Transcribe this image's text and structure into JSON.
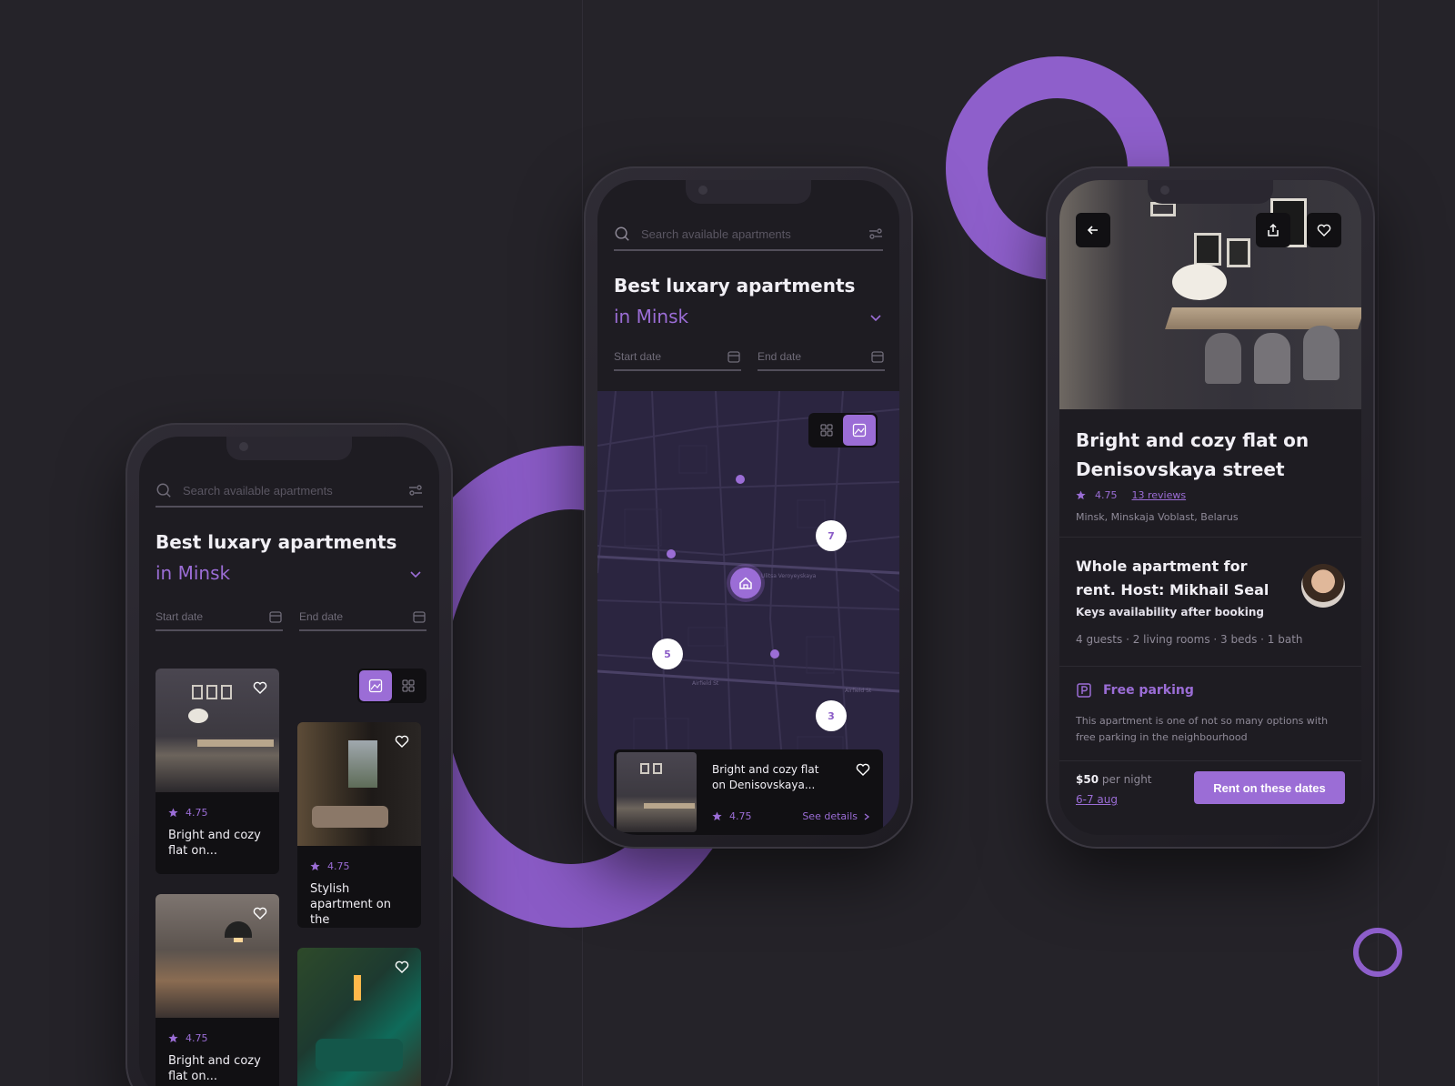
{
  "search": {
    "placeholder": "Search available apartments"
  },
  "heading": {
    "line1": "Best luxary apartments",
    "line2": "in Minsk"
  },
  "dates": {
    "start": "Start date",
    "end": "End date"
  },
  "list_cards": [
    {
      "rating": "4.75",
      "title": "Bright and cozy flat on..."
    },
    {
      "rating": "4.75",
      "title": "Stylish apartment on the"
    },
    {
      "rating": "4.75",
      "title": "Bright and cozy flat on..."
    }
  ],
  "map": {
    "clusters": [
      "7",
      "5",
      "3"
    ],
    "streets": [
      "Ulitsa Veroyeyskaya",
      "Airfield St",
      "Airfield St"
    ],
    "preview": {
      "title": "Bright and cozy flat on Denisovskaya...",
      "rating": "4.75",
      "cta": "See details"
    }
  },
  "detail": {
    "title": "Bright and cozy flat on Denisovskaya street",
    "rating": "4.75",
    "reviews": "13 reviews",
    "location": "Minsk, Minskaja Voblast, Belarus",
    "host_title": "Whole apartment for rent. Host: Mikhail Seal",
    "keys": "Keys availability after booking",
    "specs": "4 guests · 2 living rooms · 3 beds · 1 bath",
    "parking_title": "Free parking",
    "parking_desc": "This apartment is one of not so many options with free parking in the neighbourhood",
    "price": "$50",
    "per_night": "per night",
    "dates": "6-7 aug",
    "rent_label": "Rent on these dates"
  },
  "colors": {
    "accent": "#9b6dd6",
    "background": "#252329",
    "card": "#111013"
  },
  "icons": [
    "search-icon",
    "filter-icon",
    "chevron-down-icon",
    "calendar-icon",
    "heart-icon",
    "star-icon",
    "grid-icon",
    "map-icon",
    "home-icon",
    "back-arrow-icon",
    "share-icon",
    "parking-icon",
    "chevron-right-icon"
  ]
}
